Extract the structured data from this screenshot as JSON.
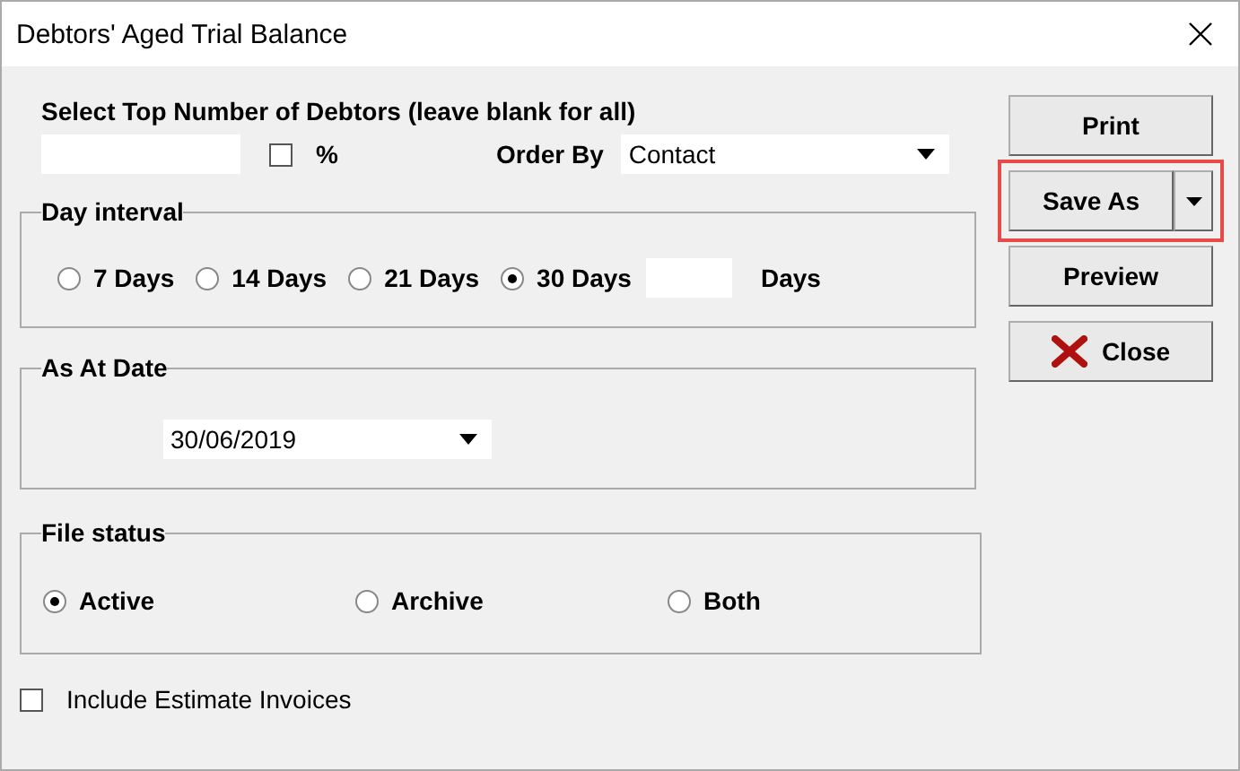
{
  "window": {
    "title": "Debtors' Aged Trial Balance"
  },
  "top_number": {
    "label": "Select Top Number of Debtors (leave blank for all)",
    "percent_checked": false,
    "percent_label": "%"
  },
  "order_by": {
    "label": "Order By",
    "value": "Contact"
  },
  "day_interval": {
    "title": "Day interval",
    "options": [
      {
        "label": "7 Days",
        "selected": false
      },
      {
        "label": "14 Days",
        "selected": false
      },
      {
        "label": "21 Days",
        "selected": false
      },
      {
        "label": "30 Days",
        "selected": true
      }
    ],
    "custom_unit": "Days"
  },
  "as_at_date": {
    "title": "As At Date",
    "value": "30/06/2019"
  },
  "file_status": {
    "title": "File status",
    "options": [
      {
        "label": "Active",
        "selected": true
      },
      {
        "label": "Archive",
        "selected": false
      },
      {
        "label": "Both",
        "selected": false
      }
    ]
  },
  "include_estimates": {
    "label": "Include Estimate Invoices",
    "checked": false
  },
  "buttons": [
    {
      "label": "Print",
      "kind": "plain",
      "highlighted": false
    },
    {
      "label": "Save As",
      "kind": "split",
      "highlighted": true
    },
    {
      "label": "Preview",
      "kind": "plain",
      "highlighted": false
    },
    {
      "label": "Close",
      "kind": "close",
      "highlighted": false
    }
  ]
}
